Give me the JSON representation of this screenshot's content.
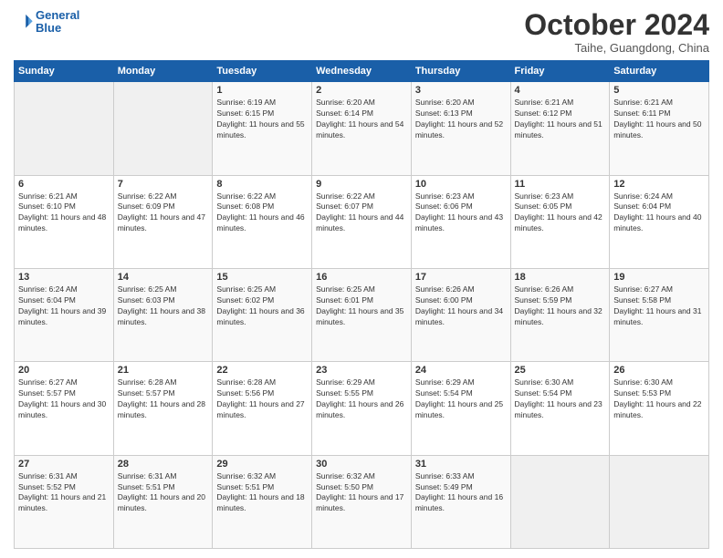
{
  "logo": {
    "line1": "General",
    "line2": "Blue"
  },
  "header": {
    "month": "October 2024",
    "location": "Taihe, Guangdong, China"
  },
  "days_of_week": [
    "Sunday",
    "Monday",
    "Tuesday",
    "Wednesday",
    "Thursday",
    "Friday",
    "Saturday"
  ],
  "weeks": [
    [
      {
        "day": "",
        "info": ""
      },
      {
        "day": "",
        "info": ""
      },
      {
        "day": "1",
        "info": "Sunrise: 6:19 AM\nSunset: 6:15 PM\nDaylight: 11 hours and 55 minutes."
      },
      {
        "day": "2",
        "info": "Sunrise: 6:20 AM\nSunset: 6:14 PM\nDaylight: 11 hours and 54 minutes."
      },
      {
        "day": "3",
        "info": "Sunrise: 6:20 AM\nSunset: 6:13 PM\nDaylight: 11 hours and 52 minutes."
      },
      {
        "day": "4",
        "info": "Sunrise: 6:21 AM\nSunset: 6:12 PM\nDaylight: 11 hours and 51 minutes."
      },
      {
        "day": "5",
        "info": "Sunrise: 6:21 AM\nSunset: 6:11 PM\nDaylight: 11 hours and 50 minutes."
      }
    ],
    [
      {
        "day": "6",
        "info": "Sunrise: 6:21 AM\nSunset: 6:10 PM\nDaylight: 11 hours and 48 minutes."
      },
      {
        "day": "7",
        "info": "Sunrise: 6:22 AM\nSunset: 6:09 PM\nDaylight: 11 hours and 47 minutes."
      },
      {
        "day": "8",
        "info": "Sunrise: 6:22 AM\nSunset: 6:08 PM\nDaylight: 11 hours and 46 minutes."
      },
      {
        "day": "9",
        "info": "Sunrise: 6:22 AM\nSunset: 6:07 PM\nDaylight: 11 hours and 44 minutes."
      },
      {
        "day": "10",
        "info": "Sunrise: 6:23 AM\nSunset: 6:06 PM\nDaylight: 11 hours and 43 minutes."
      },
      {
        "day": "11",
        "info": "Sunrise: 6:23 AM\nSunset: 6:05 PM\nDaylight: 11 hours and 42 minutes."
      },
      {
        "day": "12",
        "info": "Sunrise: 6:24 AM\nSunset: 6:04 PM\nDaylight: 11 hours and 40 minutes."
      }
    ],
    [
      {
        "day": "13",
        "info": "Sunrise: 6:24 AM\nSunset: 6:04 PM\nDaylight: 11 hours and 39 minutes."
      },
      {
        "day": "14",
        "info": "Sunrise: 6:25 AM\nSunset: 6:03 PM\nDaylight: 11 hours and 38 minutes."
      },
      {
        "day": "15",
        "info": "Sunrise: 6:25 AM\nSunset: 6:02 PM\nDaylight: 11 hours and 36 minutes."
      },
      {
        "day": "16",
        "info": "Sunrise: 6:25 AM\nSunset: 6:01 PM\nDaylight: 11 hours and 35 minutes."
      },
      {
        "day": "17",
        "info": "Sunrise: 6:26 AM\nSunset: 6:00 PM\nDaylight: 11 hours and 34 minutes."
      },
      {
        "day": "18",
        "info": "Sunrise: 6:26 AM\nSunset: 5:59 PM\nDaylight: 11 hours and 32 minutes."
      },
      {
        "day": "19",
        "info": "Sunrise: 6:27 AM\nSunset: 5:58 PM\nDaylight: 11 hours and 31 minutes."
      }
    ],
    [
      {
        "day": "20",
        "info": "Sunrise: 6:27 AM\nSunset: 5:57 PM\nDaylight: 11 hours and 30 minutes."
      },
      {
        "day": "21",
        "info": "Sunrise: 6:28 AM\nSunset: 5:57 PM\nDaylight: 11 hours and 28 minutes."
      },
      {
        "day": "22",
        "info": "Sunrise: 6:28 AM\nSunset: 5:56 PM\nDaylight: 11 hours and 27 minutes."
      },
      {
        "day": "23",
        "info": "Sunrise: 6:29 AM\nSunset: 5:55 PM\nDaylight: 11 hours and 26 minutes."
      },
      {
        "day": "24",
        "info": "Sunrise: 6:29 AM\nSunset: 5:54 PM\nDaylight: 11 hours and 25 minutes."
      },
      {
        "day": "25",
        "info": "Sunrise: 6:30 AM\nSunset: 5:54 PM\nDaylight: 11 hours and 23 minutes."
      },
      {
        "day": "26",
        "info": "Sunrise: 6:30 AM\nSunset: 5:53 PM\nDaylight: 11 hours and 22 minutes."
      }
    ],
    [
      {
        "day": "27",
        "info": "Sunrise: 6:31 AM\nSunset: 5:52 PM\nDaylight: 11 hours and 21 minutes."
      },
      {
        "day": "28",
        "info": "Sunrise: 6:31 AM\nSunset: 5:51 PM\nDaylight: 11 hours and 20 minutes."
      },
      {
        "day": "29",
        "info": "Sunrise: 6:32 AM\nSunset: 5:51 PM\nDaylight: 11 hours and 18 minutes."
      },
      {
        "day": "30",
        "info": "Sunrise: 6:32 AM\nSunset: 5:50 PM\nDaylight: 11 hours and 17 minutes."
      },
      {
        "day": "31",
        "info": "Sunrise: 6:33 AM\nSunset: 5:49 PM\nDaylight: 11 hours and 16 minutes."
      },
      {
        "day": "",
        "info": ""
      },
      {
        "day": "",
        "info": ""
      }
    ]
  ]
}
